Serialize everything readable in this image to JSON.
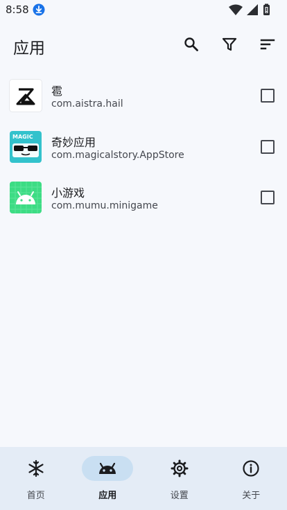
{
  "status_bar": {
    "time": "8:58",
    "icons": [
      "download-icon",
      "wifi-icon",
      "signal-icon",
      "battery-icon"
    ]
  },
  "app_bar": {
    "title": "应用",
    "actions": [
      "search-icon",
      "filter-icon",
      "sort-icon"
    ]
  },
  "apps": [
    {
      "name": "雹",
      "package": "com.aistra.hail",
      "checked": false,
      "icon": "hail-app-icon"
    },
    {
      "name": "奇妙应用",
      "package": "com.magicalstory.AppStore",
      "checked": false,
      "icon": "magic-app-icon",
      "icon_text": "MAGIC"
    },
    {
      "name": "小游戏",
      "package": "com.mumu.minigame",
      "checked": false,
      "icon": "android-app-icon"
    }
  ],
  "bottom_nav": {
    "items": [
      {
        "label": "首页",
        "icon": "snowflake-icon",
        "active": false
      },
      {
        "label": "应用",
        "icon": "android-icon",
        "active": true
      },
      {
        "label": "设置",
        "icon": "gear-icon",
        "active": false
      },
      {
        "label": "关于",
        "icon": "info-icon",
        "active": false
      }
    ]
  },
  "colors": {
    "background": "#f6f8fc",
    "nav_background": "#e4ecf6",
    "nav_active_pill": "#c9dff2",
    "accent": "#1a73e8",
    "magic_teal": "#33c2cc",
    "android_green": "#3ddc84"
  }
}
